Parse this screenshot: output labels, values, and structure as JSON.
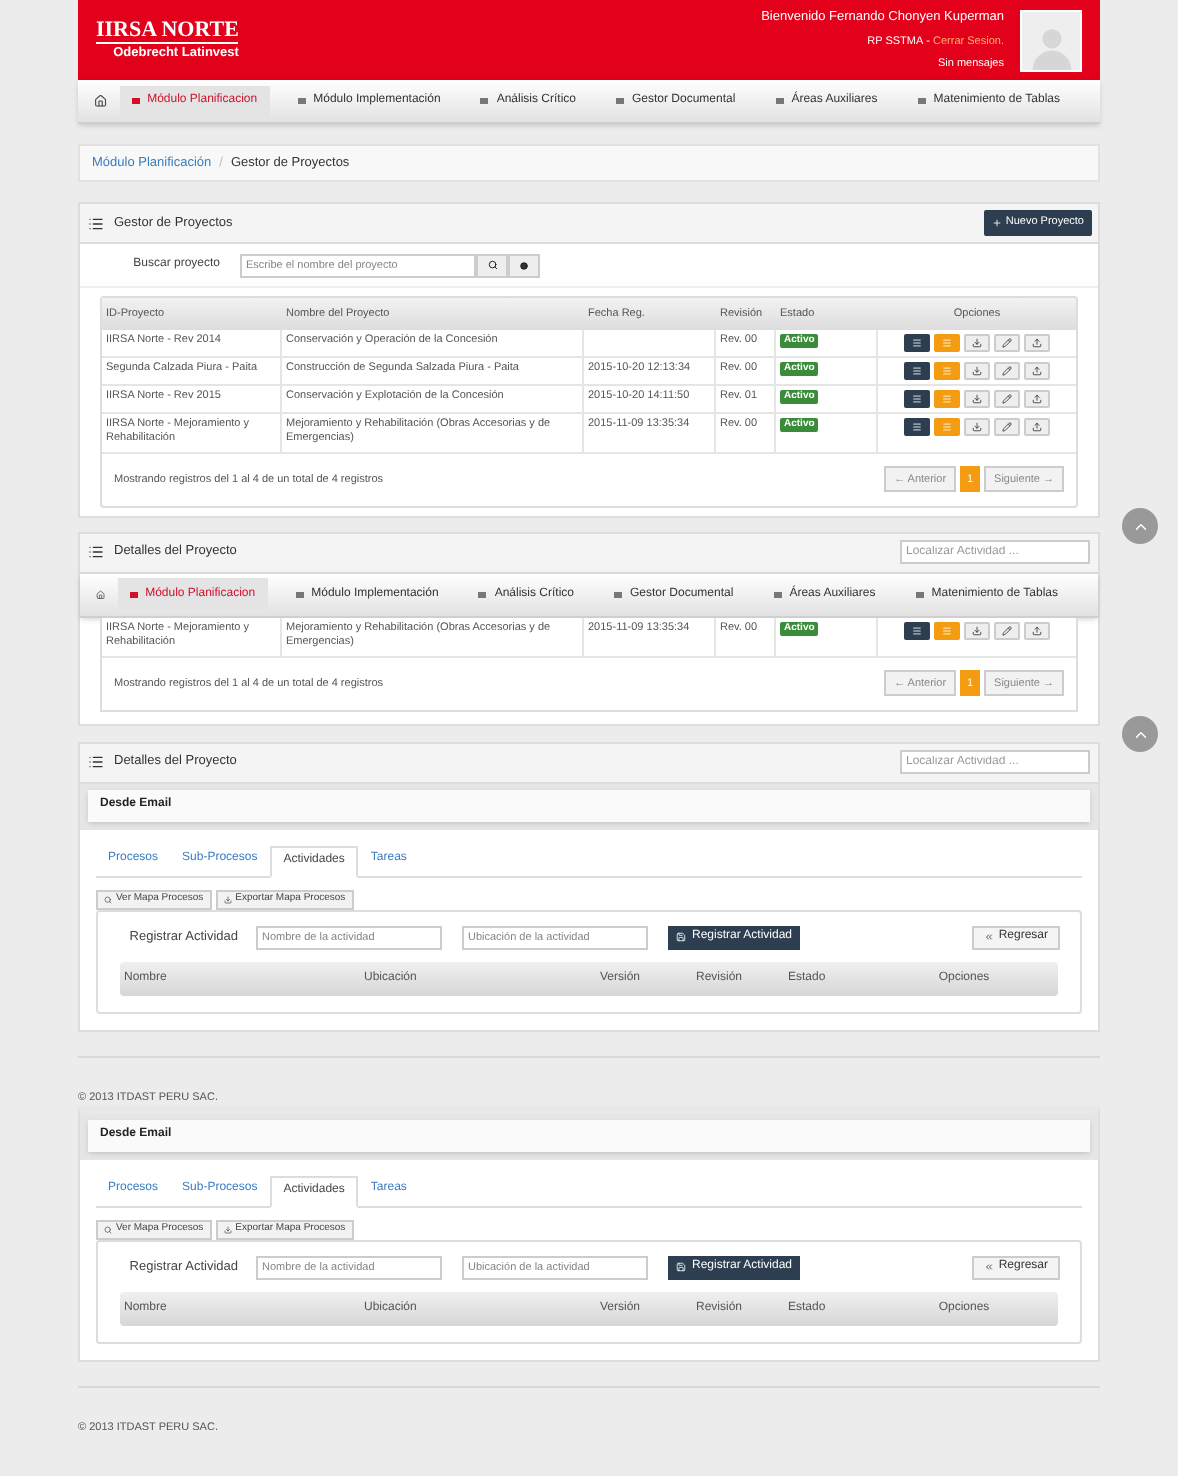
{
  "header": {
    "logo_title": "IIRSA NORTE",
    "logo_subtitle": "Odebrecht Latinvest",
    "welcome": "Bienvenido Fernando Chonyen Kuperman",
    "role": "RP SSTMA",
    "separator": " - ",
    "logout": "Cerrar Sesion.",
    "messages": "Sin mensajes"
  },
  "nav": {
    "items": [
      {
        "label": "Módulo Planificacion",
        "selected": true
      },
      {
        "label": "Módulo Implementación",
        "selected": false
      },
      {
        "label": "Análisis Crítico",
        "selected": false
      },
      {
        "label": "Gestor Documental",
        "selected": false
      },
      {
        "label": "Áreas Auxiliares",
        "selected": false
      },
      {
        "label": "Matenimiento de Tablas",
        "selected": false
      }
    ]
  },
  "breadcrumb": {
    "parent": "Módulo Planificación",
    "separator": "/",
    "current": "Gestor de Proyectos"
  },
  "project_manager": {
    "title": "Gestor de Proyectos",
    "new_button": "Nuevo Proyecto",
    "search_label": "Buscar proyecto",
    "search_placeholder": "Escribe el nombre del proyecto",
    "columns": [
      "ID-Proyecto",
      "Nombre del Proyecto",
      "Fecha Reg.",
      "Revisión",
      "Estado",
      "Opciones"
    ],
    "rows": [
      {
        "id": "IIRSA Norte - Rev 2014",
        "name": "Conservación y Operación de la Concesión",
        "date": "",
        "revision": "Rev. 00",
        "status": "Activo"
      },
      {
        "id": "Segunda Calzada Piura - Paita",
        "name": "Construcción de Segunda Salzada Piura - Paita",
        "date": "2015-10-20 12:13:34",
        "revision": "Rev. 00",
        "status": "Activo"
      },
      {
        "id": "IIRSA Norte - Rev 2015",
        "name": "Conservación y Explotación de la Concesión",
        "date": "2015-10-20 14:11:50",
        "revision": "Rev. 01",
        "status": "Activo"
      },
      {
        "id": "IIRSA Norte - Mejoramiento y Rehabilitación",
        "name": "Mejoramiento y Rehabilitación (Obras Accesorias y de Emergencias)",
        "date": "2015-11-09 13:35:34",
        "revision": "Rev. 00",
        "status": "Activo"
      }
    ],
    "info": "Mostrando registros del 1 al 4 de un total de 4 registros",
    "pagination": {
      "prev": "← Anterior",
      "pages": [
        {
          "label": "1",
          "selected": true
        }
      ],
      "next": "Siguiente →"
    }
  },
  "overlapped_panel": {
    "title": "Detalles del Proyecto",
    "search_placeholder": "Localizar Actividad ...",
    "nav": {
      "items": [
        {
          "label": "Módulo Planificacion",
          "selected": true
        },
        {
          "label": "Módulo Implementación",
          "selected": false
        },
        {
          "label": "Análisis Crítico",
          "selected": false
        },
        {
          "label": "Gestor Documental",
          "selected": false
        },
        {
          "label": "Áreas Auxiliares",
          "selected": false
        },
        {
          "label": "Matenimiento de Tablas",
          "selected": false
        }
      ]
    },
    "rows": [
      {
        "id": "IIRSA Norte - Mejoramiento y Rehabilitación",
        "name": "Mejoramiento y Rehabilitación (Obras Accesorias y de Emergencias)",
        "date": "2015-11-09 13:35:34",
        "revision": "Rev. 00",
        "status": "Activo"
      }
    ],
    "info": "Mostrando registros del 1 al 4 de un total de 4 registros",
    "pagination": {
      "prev": "← Anterior",
      "pages": [
        {
          "label": "1",
          "selected": true
        }
      ],
      "next": "Siguiente →"
    }
  },
  "details_panels": [
    {
      "title": "Detalles del Proyecto",
      "search_placeholder": "Localizar Actividad ...",
      "subheader": "Desde Email",
      "tabs": [
        {
          "label": "Procesos",
          "selected": false
        },
        {
          "label": "Sub-Procesos",
          "selected": false
        },
        {
          "label": "Actividades",
          "selected": true
        },
        {
          "label": "Tareas",
          "selected": false
        }
      ],
      "map_buttons": [
        "Ver Mapa Procesos",
        "Exportar Mapa Procesos"
      ],
      "register_label": "Registrar Actividad",
      "name_placeholder": "Nombre de la actividad",
      "location_placeholder": "Ubicación de la actividad",
      "register_button": "Registrar Actividad",
      "back_button": "Regresar",
      "columns": [
        "Nombre",
        "Ubicación",
        "Versión",
        "Revisión",
        "Estado",
        "Opciones"
      ],
      "footer": "© 2013 ITDAST PERU SAC."
    },
    {
      "subheader": "Desde Email",
      "tabs": [
        {
          "label": "Procesos",
          "selected": false
        },
        {
          "label": "Sub-Procesos",
          "selected": false
        },
        {
          "label": "Actividades",
          "selected": true
        },
        {
          "label": "Tareas",
          "selected": false
        }
      ],
      "map_buttons": [
        "Ver Mapa Procesos",
        "Exportar Mapa Procesos"
      ],
      "register_label": "Registrar Actividad",
      "name_placeholder": "Nombre de la actividad",
      "location_placeholder": "Ubicación de la actividad",
      "register_button": "Registrar Actividad",
      "back_button": "Regresar",
      "columns": [
        "Nombre",
        "Ubicación",
        "Versión",
        "Revisión",
        "Estado",
        "Opciones"
      ],
      "footer": "© 2013 ITDAST PERU SAC."
    }
  ]
}
